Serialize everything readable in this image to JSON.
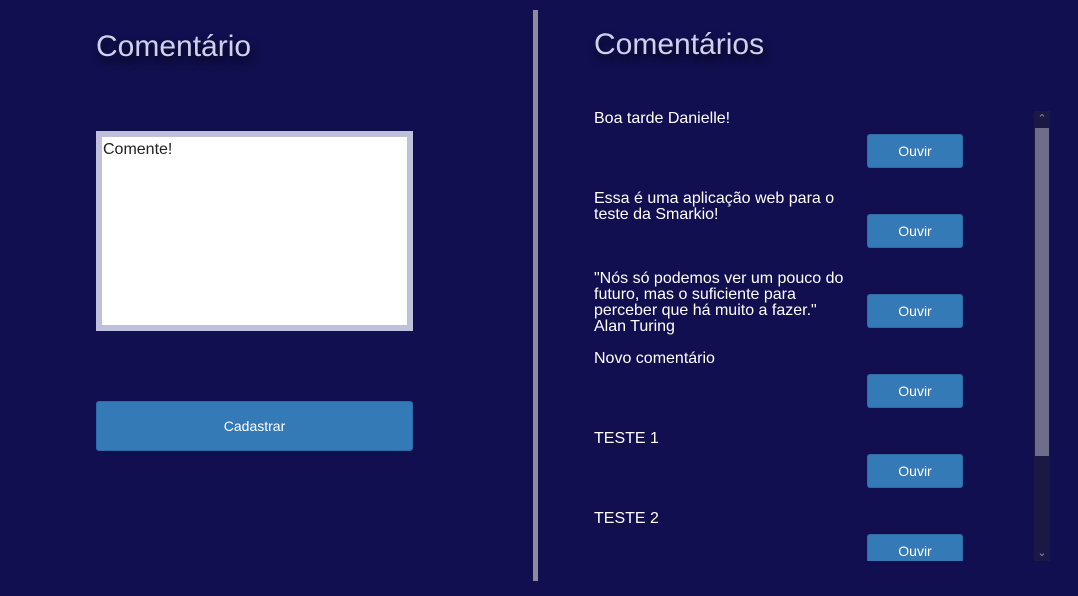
{
  "left": {
    "title": "Comentário",
    "textarea_placeholder": "Comente!",
    "submit_label": "Cadastrar"
  },
  "right": {
    "title": "Comentários",
    "comments": [
      {
        "text": "Boa tarde Danielle!",
        "button": "Ouvir"
      },
      {
        "text": "Essa é uma aplicação web para o teste da Smarkio!",
        "button": "Ouvir"
      },
      {
        "text": "\"Nós só podemos ver um pouco do futuro, mas o suficiente para perceber que há muito a fazer.\" Alan Turing",
        "button": "Ouvir"
      },
      {
        "text": "Novo comentário",
        "button": "Ouvir"
      },
      {
        "text": "TESTE 1",
        "button": "Ouvir"
      },
      {
        "text": "TESTE 2",
        "button": "Ouvir"
      }
    ]
  },
  "colors": {
    "background": "#110f4f",
    "button": "#337ab7",
    "divider": "#8c8c9a",
    "title": "#cfd1ec"
  },
  "icons": {
    "scroll_up": "chevron-up-icon",
    "scroll_down": "chevron-down-icon"
  }
}
